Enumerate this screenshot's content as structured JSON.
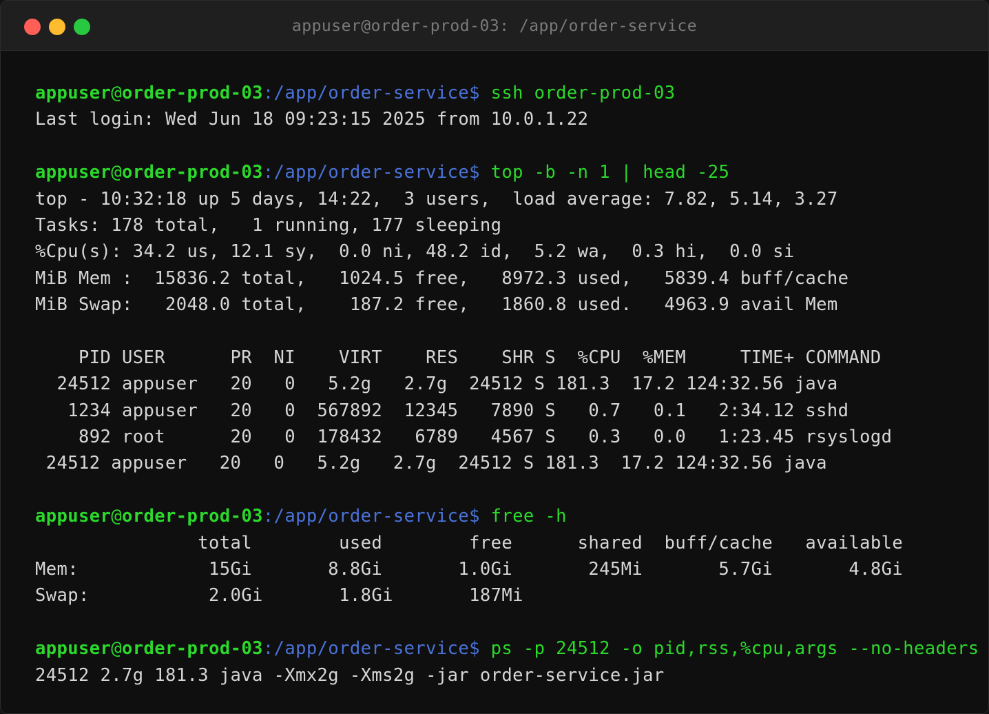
{
  "window": {
    "title": "appuser@order-prod-03: /app/order-service"
  },
  "prompt": {
    "user": "appuser",
    "at": "@",
    "host": "order-prod-03",
    "sep": ":",
    "path": "/app/order-service",
    "symbol": "$"
  },
  "blocks": [
    {
      "command": " ssh order-prod-03",
      "output": [
        "Last login: Wed Jun 18 09:23:15 2025 from 10.0.1.22"
      ]
    },
    {
      "command": " top -b -n 1 | head -25",
      "output": [
        "top - 10:32:18 up 5 days, 14:22,  3 users,  load average: 7.82, 5.14, 3.27",
        "Tasks: 178 total,   1 running, 177 sleeping",
        "%Cpu(s): 34.2 us, 12.1 sy,  0.0 ni, 48.2 id,  5.2 wa,  0.3 hi,  0.0 si",
        "MiB Mem :  15836.2 total,   1024.5 free,   8972.3 used,   5839.4 buff/cache",
        "MiB Swap:   2048.0 total,    187.2 free,   1860.8 used.   4963.9 avail Mem",
        "",
        "    PID USER      PR  NI    VIRT    RES    SHR S  %CPU  %MEM     TIME+ COMMAND",
        "  24512 appuser   20   0   5.2g   2.7g  24512 S 181.3  17.2 124:32.56 java",
        "   1234 appuser   20   0  567892  12345   7890 S   0.7   0.1   2:34.12 sshd",
        "    892 root      20   0  178432   6789   4567 S   0.3   0.0   1:23.45 rsyslogd",
        " 24512 appuser   20   0   5.2g   2.7g  24512 S 181.3  17.2 124:32.56 java"
      ]
    },
    {
      "command": " free -h",
      "output": [
        "               total        used        free      shared  buff/cache   available",
        "Mem:            15Gi       8.8Gi       1.0Gi       245Mi       5.7Gi       4.8Gi",
        "Swap:           2.0Gi       1.8Gi       187Mi"
      ]
    },
    {
      "command": " ps -p 24512 -o pid,rss,%cpu,args --no-headers",
      "output": [
        "24512 2.7g 181.3 java -Xmx2g -Xms2g -jar order-service.jar"
      ]
    }
  ]
}
